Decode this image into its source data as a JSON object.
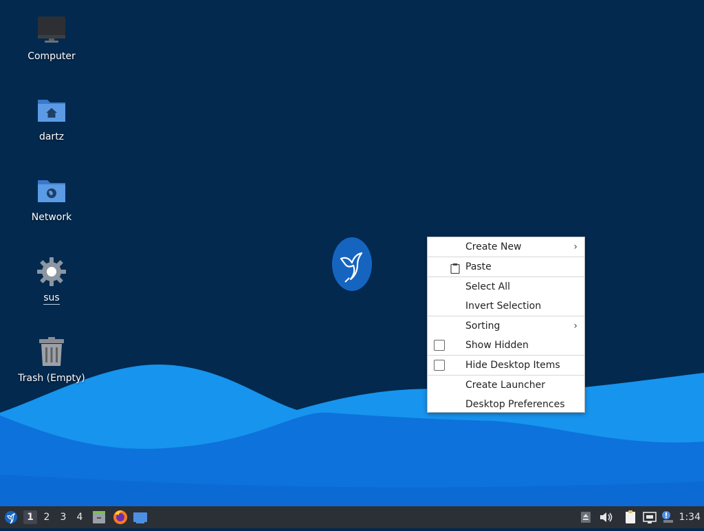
{
  "desktop": {
    "icons": [
      {
        "label": "Computer",
        "icon": "computer-icon"
      },
      {
        "label": "dartz",
        "icon": "home-folder-icon"
      },
      {
        "label": "Network",
        "icon": "network-folder-icon"
      },
      {
        "label": "sus",
        "icon": "gear-icon"
      },
      {
        "label": "Trash (Empty)",
        "icon": "trash-icon"
      }
    ]
  },
  "context_menu": {
    "items": [
      {
        "label": "Create New",
        "submenu": true
      },
      {
        "label": "Paste",
        "icon": "clipboard-icon"
      },
      {
        "label": "Select All"
      },
      {
        "label": "Invert Selection"
      },
      {
        "label": "Sorting",
        "submenu": true
      },
      {
        "label": "Show Hidden",
        "checkbox": true,
        "checked": false
      },
      {
        "label": "Hide Desktop Items",
        "checkbox": true,
        "checked": false
      },
      {
        "label": "Create Launcher"
      },
      {
        "label": "Desktop Preferences"
      }
    ]
  },
  "taskbar": {
    "workspaces": [
      "1",
      "2",
      "3",
      "4"
    ],
    "active_workspace": "1",
    "clock": "1:34",
    "colors": {
      "background": "#2b2f36"
    }
  },
  "colors": {
    "desktop_background": "#03294f",
    "wave_light": "#1d9bf0",
    "wave_dark": "#0a6fd9",
    "logo_blue": "#1565c0"
  }
}
